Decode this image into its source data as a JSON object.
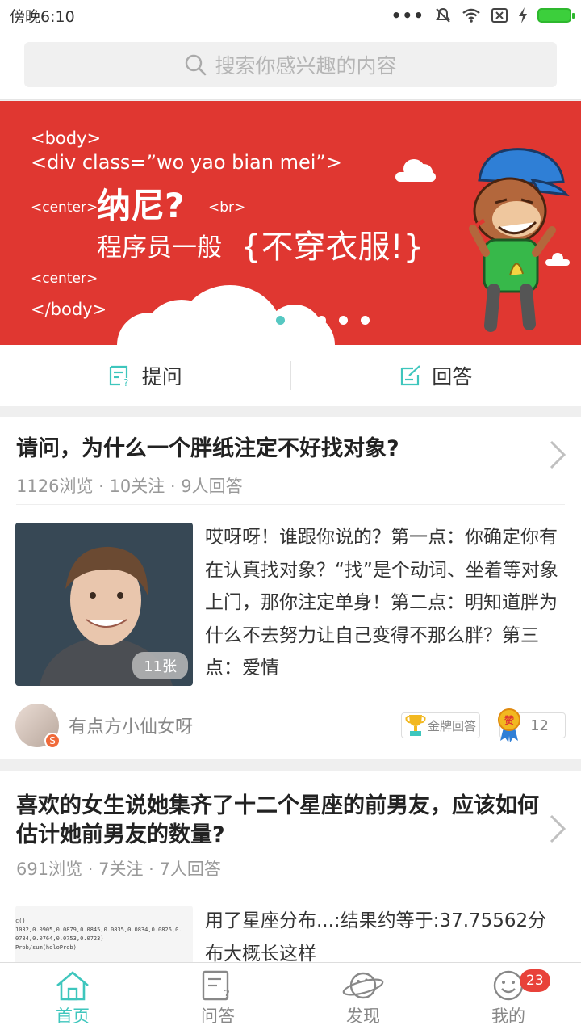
{
  "status_bar": {
    "time": "傍晚6:10",
    "more": "•••"
  },
  "search": {
    "placeholder": "搜索你感兴趣的内容"
  },
  "banner": {
    "line_body_open": "<body>",
    "line_div": "<div class=”wo yao bian mei”>",
    "line_center1": "<center>",
    "headline": "纳尼?",
    "line_br": "<br>",
    "subline": "程序员一般",
    "highlight": "{不穿衣服!}",
    "line_center2": "<center>",
    "line_body_close": "</body>",
    "slides_count": 4,
    "active_slide": 0
  },
  "actions": {
    "ask": "提问",
    "answer": "回答"
  },
  "feed": [
    {
      "title": "请问，为什么一个胖纸注定不好找对象?",
      "meta": "1126浏览 · 10关注 · 9人回答",
      "image_count": "11张",
      "answer": "哎呀呀！谁跟你说的？第一点：你确定你有在认真找对象？“找”是个动词、坐着等对象上门，那你注定单身！第二点：明知道胖为什么不去努力让自己变得不那么胖？第三点：爱情",
      "author": "有点方小仙女呀",
      "author_badge": "S",
      "gold_tag": "金牌回答",
      "likes": "12"
    },
    {
      "title": "喜欢的女生说她集齐了十二个星座的前男友，应该如何估计她前男友的数量?",
      "meta": "691浏览 · 7关注 · 7人回答",
      "answer": "用了星座分布...:结果约等于:37.75562分布大概长这样",
      "code_line1": "c()",
      "code_line2": "1032,0.0905,0.0879,0.0845,0.0835,0.0834,0.0826,0.",
      "code_line3": "0784,0.0764,0.0753,0.0723)",
      "code_line4": "Prob/sum(holoProb)"
    }
  ],
  "nav": {
    "home": "首页",
    "qa": "问答",
    "discover": "发现",
    "me": "我的",
    "me_badge": "23"
  },
  "colors": {
    "accent": "#3ec6bd",
    "banner_red": "#e03731",
    "badge_red": "#e8423a"
  }
}
